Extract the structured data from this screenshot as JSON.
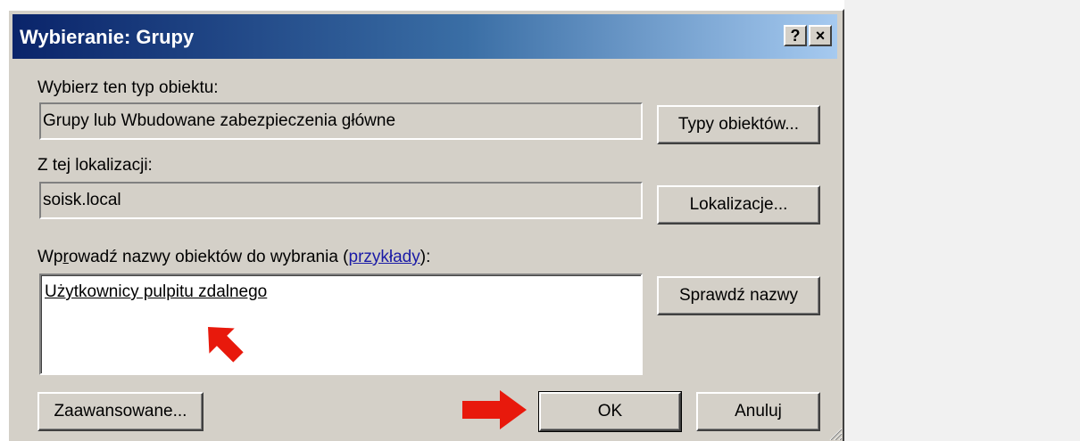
{
  "dialog": {
    "title": "Wybieranie: Grupy",
    "help_glyph": "?",
    "close_glyph": "×",
    "object_type": {
      "label": "Wybierz ten typ obiektu:",
      "value": "Grupy lub Wbudowane zabezpieczenia główne",
      "button": "Typy obiektów..."
    },
    "location": {
      "label": "Z tej lokalizacji:",
      "value": "soisk.local",
      "button": "Lokalizacje..."
    },
    "names": {
      "label_pre": "Wp",
      "label_mnemonic": "r",
      "label_mid": "owadź nazwy obiektów do wybrania (",
      "examples_link": "przykłady",
      "label_post": "):",
      "value": "Użytkownicy pulpitu zdalnego",
      "check_button": "Sprawdź nazwy"
    },
    "advanced_button": "Zaawansowane...",
    "ok_button": "OK",
    "cancel_button": "Anuluj"
  },
  "annotations": {
    "arrow_color": "#e8190c"
  }
}
